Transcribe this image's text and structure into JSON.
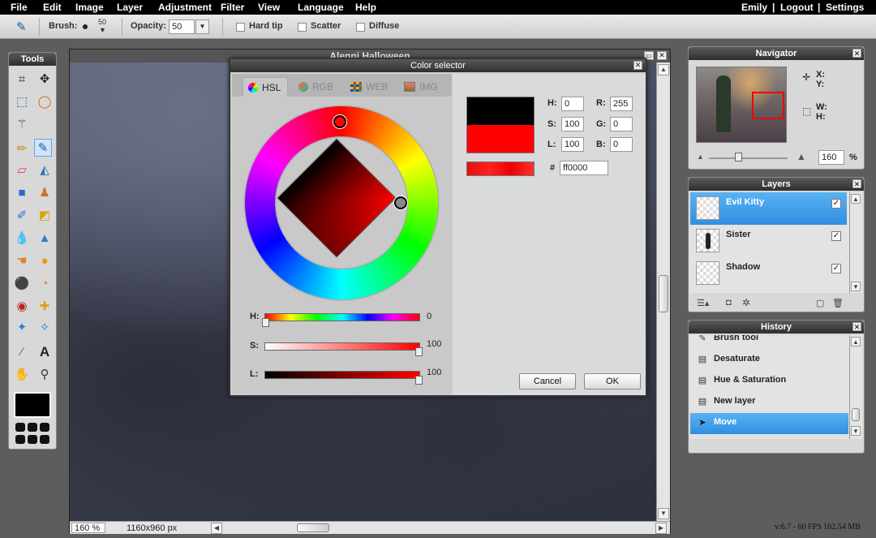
{
  "menubar": {
    "items": [
      "File",
      "Edit",
      "Image",
      "Layer",
      "Adjustment",
      "Filter",
      "View",
      "Language",
      "Help"
    ],
    "user": "Emily",
    "logout": "Logout",
    "settings": "Settings",
    "sep": "|"
  },
  "toolbar": {
    "brush_label": "Brush:",
    "brush_size": "50",
    "opacity_label": "Opacity:",
    "opacity_value": "50",
    "hard_tip": "Hard tip",
    "scatter": "Scatter",
    "diffuse": "Diffuse"
  },
  "tools_panel": {
    "title": "Tools"
  },
  "canvas": {
    "title": "Alenni Halloween",
    "zoom": "160",
    "zoom_unit": "%",
    "dimensions": "1160x960 px"
  },
  "color_dialog": {
    "title": "Color selector",
    "tabs": [
      "HSL",
      "RGB",
      "WEB",
      "IMG"
    ],
    "h_label": "H:",
    "h_value": "0",
    "s_label": "S:",
    "s_value": "100",
    "l_label": "L:",
    "l_value": "100",
    "r_label": "R:",
    "r_value": "255",
    "g_label": "G:",
    "g_value": "0",
    "b_label": "B:",
    "b_value": "0",
    "hash": "#",
    "hex_value": "ff0000",
    "slider_h_label": "H:",
    "slider_h_value": "0",
    "slider_s_label": "S:",
    "slider_s_value": "100",
    "slider_l_label": "L:",
    "slider_l_value": "100",
    "cancel": "Cancel",
    "ok": "OK",
    "old_color": "#000000",
    "new_color": "#ff0000"
  },
  "navigator": {
    "title": "Navigator",
    "x_label": "X:",
    "y_label": "Y:",
    "w_label": "W:",
    "h_label": "H:",
    "zoom_value": "160",
    "zoom_unit": "%"
  },
  "layers": {
    "title": "Layers",
    "items": [
      {
        "name": "Evil Kitty",
        "checked": "✓"
      },
      {
        "name": "Sister",
        "checked": "✓"
      },
      {
        "name": "Shadow",
        "checked": "✓"
      }
    ]
  },
  "history": {
    "title": "History",
    "items": [
      "Brush tool",
      "Desaturate",
      "Hue & Saturation",
      "New layer",
      "Move"
    ]
  },
  "status": {
    "text": "v:6.7 - 60 FPS 162.54 MB"
  },
  "colors": {
    "accent": "#2f8fe0",
    "panel_bg": "#d8d8d8",
    "title_bar": "#2e2e2e"
  }
}
